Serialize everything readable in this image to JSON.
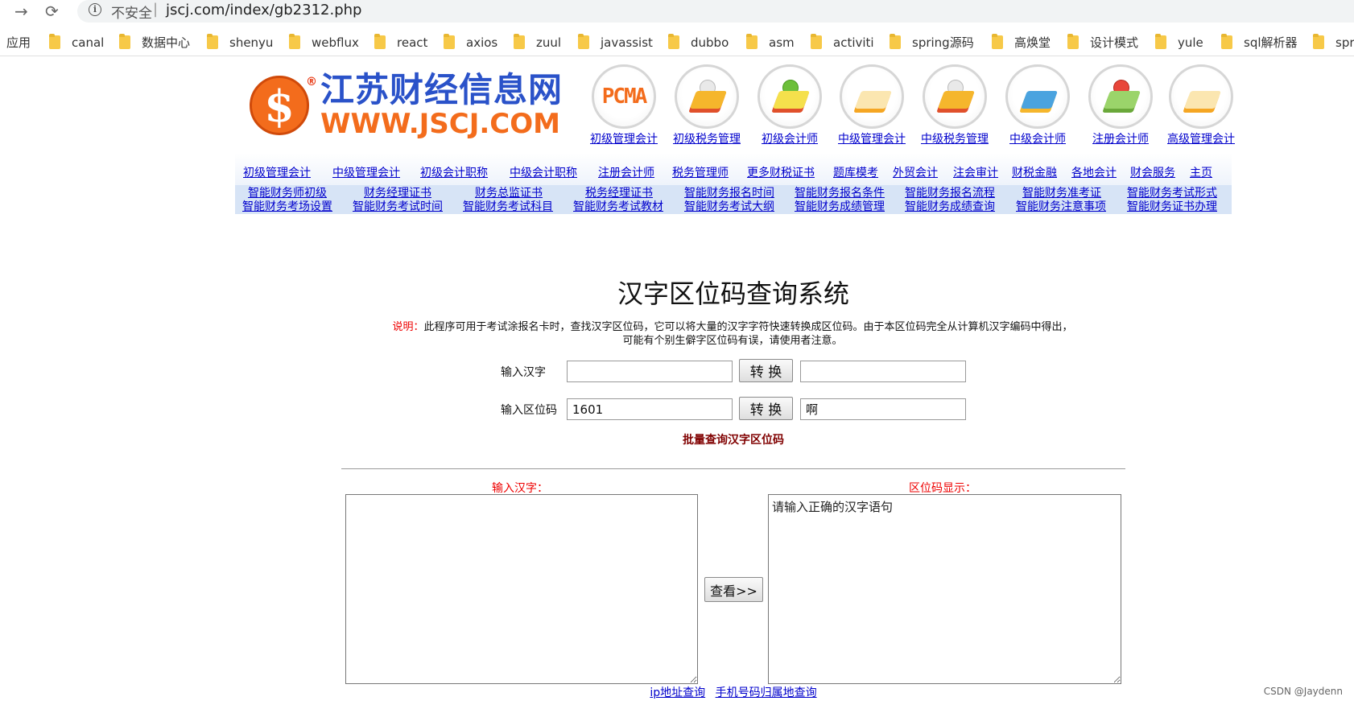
{
  "browser": {
    "insecure_label": "不安全",
    "separator": "|",
    "url": "jscj.com/index/gb2312.php",
    "back_icon": "arrow-right-icon",
    "reload_icon": "reload-icon",
    "apps_label": "应用",
    "bookmarks": [
      "canal",
      "数据中心",
      "shenyu",
      "webflux",
      "react",
      "axios",
      "zuul",
      "javassist",
      "dubbo",
      "asm",
      "activiti",
      "spring源码",
      "高焕堂",
      "设计模式",
      "yule",
      "sql解析器",
      "spr"
    ]
  },
  "logo": {
    "dollar": "$",
    "reg": "®",
    "cn": "江苏财经信息网",
    "en": "WWW.JSCJ.COM",
    "brand_blue": "#2a52c9",
    "brand_orange": "#f36c1c"
  },
  "cert_icons": {
    "pcma_text": "PCMA",
    "labels": [
      "初级管理会计",
      "初级税务管理",
      "初级会计师",
      "中级管理会计",
      "中级税务管理",
      "中级会计师",
      "注册会计师",
      "高级管理会计"
    ]
  },
  "nav1": [
    "初级管理会计",
    "中级管理会计",
    "初级会计职称",
    "中级会计职称",
    "注册会计师",
    "税务管理师",
    "更多财税证书",
    "题库模考",
    "外贸会计",
    "注会审计",
    "财税金融",
    "各地会计",
    "财会服务",
    "主页"
  ],
  "nav2": {
    "row1": [
      "智能财务师初级",
      "财务经理证书",
      "财务总监证书",
      "税务经理证书",
      "智能财务报名时间",
      "智能财务报名条件",
      "智能财务报名流程",
      "智能财务准考证",
      "智能财务考试形式"
    ],
    "row2": [
      "智能财务考场设置",
      "智能财务考试时间",
      "智能财务考试科目",
      "智能财务考试教材",
      "智能财务考试大纲",
      "智能财务成绩管理",
      "智能财务成绩查询",
      "智能财务注意事项",
      "智能财务证书办理"
    ]
  },
  "main": {
    "title": "汉字区位码查询系统",
    "desc_label": "说明：",
    "desc_line1": "此程序可用于考试涂报名卡时，查找汉字区位码，它可以将大量的汉字字符快速转换成区位码。由于本区位码完全从计算机汉字编码中得出，",
    "desc_line2": "可能有个别生僻字区位码有误，请使用者注意。",
    "row1_label": "输入汉字",
    "row1_input": "",
    "row1_output": "",
    "convert_label": "转 换",
    "row2_label": "输入区位码",
    "row2_input": "1601",
    "row2_output": "啊",
    "batch_title": "批量查询汉字区位码",
    "input_label": "输入汉字：",
    "output_label": "区位码显示：",
    "input_text": "",
    "output_text": "请输入正确的汉字语句",
    "view_button": "查看>>",
    "link_ip": "ip地址查询",
    "link_phone": "手机号码归属地查询"
  },
  "watermark": "CSDN @Jaydenn"
}
